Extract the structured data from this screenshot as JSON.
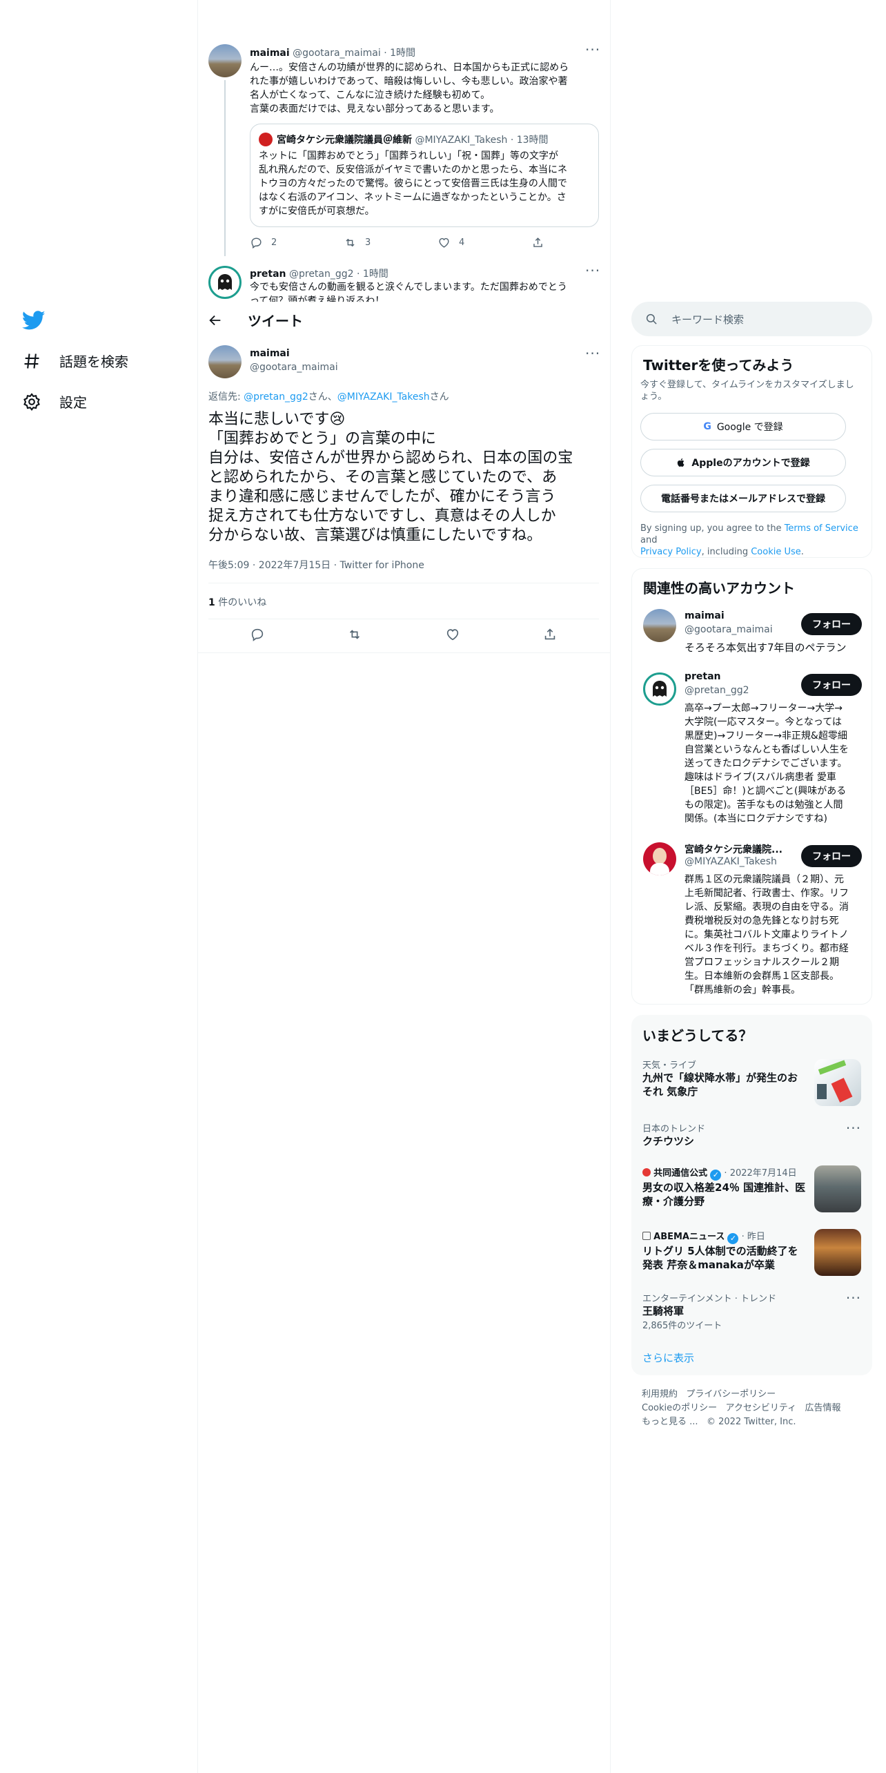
{
  "nav": {
    "explore_label": "話題を検索",
    "settings_label": "設定"
  },
  "thread": {
    "parent": {
      "name": "maimai",
      "handle_time": "@gootara_maimai · 1時間",
      "text_lines": [
        "んー…。安倍さんの功績が世界的に認められ、日本国からも正式に認めら",
        "れた事が嬉しいわけであって、暗殺は悔しいし、今も悲しい。政治家や著",
        "名人が亡くなって、こんなに泣き続けた経験も初めて。",
        "言葉の表面だけでは、見えない部分ってあると思います。"
      ],
      "quote": {
        "name": "宮崎タケシ元衆議院議員＠維新",
        "handle_time": "@MIYAZAKI_Takesh · 13時間",
        "text_lines": [
          "ネットに「国葬おめでとう」「国葬うれしい」「祝・国葬」等の文字が",
          "乱れ飛んだので、反安倍派がイヤミで書いたのかと思ったら、本当にネ",
          "トウヨの方々だったので驚愕。彼らにとって安倍晋三氏は生身の人間で",
          "はなく右派のアイコン、ネットミームに過ぎなかったということか。さ",
          "すがに安倍氏が可哀想だ。"
        ]
      },
      "replies": "2",
      "retweets": "3",
      "likes": "4"
    },
    "second": {
      "name": "pretan",
      "handle_time": "@pretan_gg2 · 1時間",
      "text_lines": [
        "今でも安倍さんの動画を観ると涙ぐんでしまいます。ただ国葬おめでとう",
        "って何？頭が煮え繰り返るわ！"
      ]
    }
  },
  "header": {
    "title": "ツイート"
  },
  "main_tweet": {
    "name": "maimai",
    "handle": "@gootara_maimai",
    "reply_prefix": "返信先: ",
    "reply_to_1": "@pretan_gg2",
    "reply_san_1": "さん、",
    "reply_to_2": "@MIYAZAKI_Takesh",
    "reply_san_2": "さん",
    "text_lines": [
      "本当に悲しいです😢",
      "「国葬おめでとう」の言葉の中に",
      "自分は、安倍さんが世界から認められ、日本の国の宝",
      "と認められたから、その言葉と感じていたので、あ",
      "まり違和感に感じませんでしたが、確かにそう言う",
      "捉え方されても仕方ないですし、真意はその人しか",
      "分からない故、言葉選びは慎重にしたいですね。"
    ],
    "meta": "午後5:09 · 2022年7月15日 · Twitter for iPhone",
    "likes_count": "1",
    "likes_label": " 件のいいね"
  },
  "search": {
    "placeholder": "キーワード検索"
  },
  "signup": {
    "title": "Twitterを使ってみよう",
    "subtitle": "今すぐ登録して、タイムラインをカスタマイズしましょう。",
    "google_label": "Google で登録",
    "apple_label": "Appleのアカウントで登録",
    "phone_label": "電話番号またはメールアドレスで登録",
    "terms_prefix": "By signing up, you agree to the ",
    "terms_link": "Terms of Service",
    "terms_and": " and",
    "privacy_link": "Privacy Policy",
    "including": ", including ",
    "cookie_link": "Cookie Use",
    "period": "."
  },
  "related": {
    "title": "関連性の高いアカウント",
    "follow_label": "フォロー",
    "accounts": [
      {
        "name": "maimai",
        "handle": "@gootara_maimai",
        "bio_lines": [
          "そろそろ本気出す7年目のペテラン"
        ]
      },
      {
        "name": "pretan",
        "handle": "@pretan_gg2",
        "bio_lines": [
          "高卒→プー太郎→フリーター→大学→",
          "大学院(一応マスター。今となっては",
          "黒歴史)→フリーター→非正規&超零細",
          "自営業というなんとも香ばしい人生を",
          "送ってきたロクデナシでございます。",
          "趣味はドライブ(スバル病患者 愛車",
          "［BE5］命！)と調べごと(興味がある",
          "もの限定)。苦手なものは勉強と人間",
          "関係。(本当にロクデナシですね)"
        ]
      },
      {
        "name": "宮崎タケシ元衆議院...",
        "handle": "@MIYAZAKI_Takesh",
        "bio_lines": [
          "群馬１区の元衆議院議員（２期）、元",
          "上毛新聞記者、行政書士、作家。リフ",
          "レ派、反緊縮。表現の自由を守る。消",
          "費税増税反対の急先鋒となり討ち死",
          "に。集英社コバルト文庫よりライトノ",
          "ベル３作を刊行。まちづくり。都市経",
          "営プロフェッショナルスクール２期",
          "生。日本維新の会群馬１区支部長。",
          "「群馬維新の会」幹事長。"
        ]
      }
    ]
  },
  "trends": {
    "title": "いまどうしてる？",
    "items": [
      {
        "context": "天気・ライブ",
        "title_lines": [
          "九州で「線状降水帯」が発生のお",
          "それ 気象庁"
        ]
      },
      {
        "context": "日本のトレンド",
        "title_lines": [
          "クチウツシ"
        ]
      },
      {
        "context_source": "共同通信公式",
        "context_time": " · 2022年7月14日",
        "title_lines": [
          "男女の収入格差24％ 国連推計、医",
          "療・介護分野"
        ]
      },
      {
        "context_source": "ABEMAニュース",
        "context_time": " · 昨日",
        "title_lines": [
          "リトグリ 5人体制での活動終了を",
          "発表 芹奈＆manakaが卒業"
        ]
      },
      {
        "context": "エンターテインメント · トレンド",
        "title_lines": [
          "王騎将軍"
        ],
        "count": "2,865件のツイート"
      }
    ],
    "show_more": "さらに表示"
  },
  "footer": {
    "terms": "利用規約",
    "privacy": "プライバシーポリシー",
    "cookie": "Cookieのポリシー",
    "accessibility": "アクセシビリティ",
    "ads": "広告情報",
    "more": "もっと見る ...",
    "copyright": "© 2022 Twitter, Inc."
  },
  "colors": {
    "accent": "#1d9bf0",
    "text": "#0f1419",
    "muted": "#536471",
    "border": "#eff3f4"
  }
}
